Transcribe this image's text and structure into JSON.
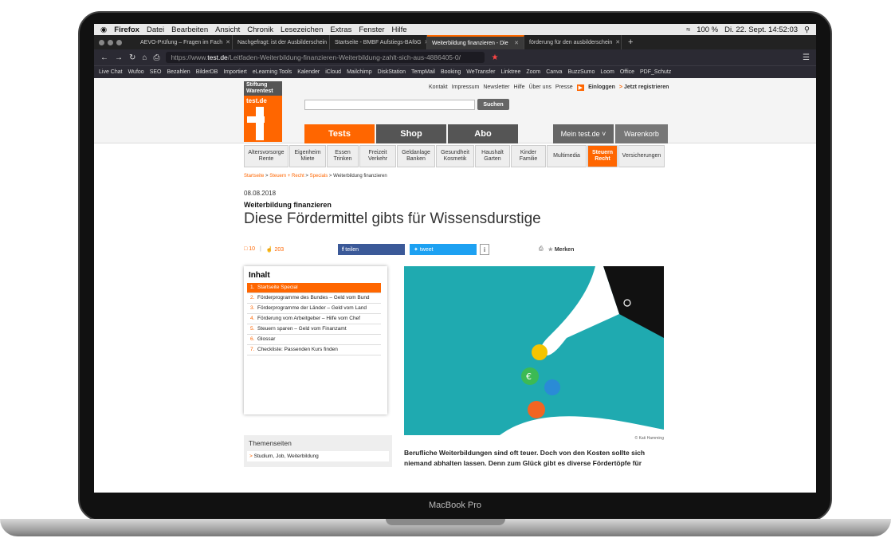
{
  "device": {
    "label": "MacBook Pro"
  },
  "menubar": {
    "apple": "",
    "app": "Firefox",
    "items": [
      "Datei",
      "Bearbeiten",
      "Ansicht",
      "Chronik",
      "Lesezeichen",
      "Extras",
      "Fenster",
      "Hilfe"
    ],
    "battery": "100 %",
    "datetime": "Di. 22. Sept. 14:52:03"
  },
  "tabs": [
    {
      "label": "AEVO-Prüfung – Fragen im Fach"
    },
    {
      "label": "Nachgefragt: ist der Ausbilderschein"
    },
    {
      "label": "Startseite - BMBF Aufstiegs-BAföG"
    },
    {
      "label": "Weiterbildung finanzieren - Die"
    },
    {
      "label": "förderung für den ausbilderschein"
    }
  ],
  "url": {
    "prefix": "https://www.",
    "domain": "test.de",
    "path": "/Leitfaden-Weiterbildung-finanzieren-Weiterbildung-zahlt-sich-aus-4886405-0/"
  },
  "bookmarks": [
    "Live Chat",
    "Wufoo",
    "SEO",
    "Bezahlen",
    "BilderDB",
    "Importiert",
    "eLearning Tools",
    "Kalender",
    "iCloud",
    "Mailchimp",
    "DiskStation",
    "TempMail",
    "Booking",
    "WeTransfer",
    "Linktree",
    "Zoom",
    "Canva",
    "BuzzSumo",
    "Loom",
    "Office",
    "PDF_Schutz"
  ],
  "site": {
    "logo": {
      "line1": "Stiftung",
      "line2": "Warentest",
      "domain": "test.de"
    },
    "toplinks": [
      "Kontakt",
      "Impressum",
      "Newsletter",
      "Hilfe",
      "Über uns",
      "Presse"
    ],
    "login": "Einloggen",
    "register": "Jetzt registrieren",
    "search_button": "Suchen",
    "nav": [
      {
        "label": "Tests",
        "color": "#ff6600"
      },
      {
        "label": "Shop",
        "color": "#555555"
      },
      {
        "label": "Abo",
        "color": "#555555"
      }
    ],
    "mein": "Mein test.de",
    "warenkorb": "Warenkorb",
    "categories": [
      {
        "l1": "Altersvorsorge",
        "l2": "Rente"
      },
      {
        "l1": "Eigenheim",
        "l2": "Miete"
      },
      {
        "l1": "Essen",
        "l2": "Trinken"
      },
      {
        "l1": "Freizeit",
        "l2": "Verkehr"
      },
      {
        "l1": "Geldanlage",
        "l2": "Banken"
      },
      {
        "l1": "Gesundheit",
        "l2": "Kosmetik"
      },
      {
        "l1": "Haushalt",
        "l2": "Garten"
      },
      {
        "l1": "Kinder",
        "l2": "Familie"
      },
      {
        "l1": "Multimedia",
        "l2": ""
      },
      {
        "l1": "Steuern",
        "l2": "Recht"
      },
      {
        "l1": "Versicherungen",
        "l2": ""
      }
    ]
  },
  "breadcrumb": [
    "Startseite",
    "Steuern + Recht",
    "Specials",
    "Weiterbildung finanzieren"
  ],
  "article": {
    "date": "08.08.2018",
    "kicker": "Weiterbildung finanzieren",
    "headline": "Diese Fördermittel gibts für Wissensdurstige",
    "comments": "10",
    "likes": "203",
    "share_fb": "teilen",
    "share_tw": "tweet",
    "info": "i",
    "merken": "Merken",
    "credit": "© Kati Hamming",
    "intro": "Berufliche Weiterbildungen sind oft teuer. Doch von den Kosten sollte sich niemand abhalten lassen. Denn zum Glück gibt es diverse Fördertöpfe für"
  },
  "toc": {
    "title": "Inhalt",
    "items": [
      {
        "n": "1.",
        "label": "Startseite Special"
      },
      {
        "n": "2.",
        "label": "Förderprogramme des Bundes – Geld vom Bund"
      },
      {
        "n": "3.",
        "label": "Förderprogramme der Länder – Geld vom Land"
      },
      {
        "n": "4.",
        "label": "Förderung vom Arbeitgeber – Hilfe vom Chef"
      },
      {
        "n": "5.",
        "label": "Steuern sparen – Geld vom Finanzamt"
      },
      {
        "n": "6.",
        "label": "Glossar"
      },
      {
        "n": "7.",
        "label": "Checkliste: Passenden Kurs finden"
      }
    ]
  },
  "themen": {
    "title": "Themenseiten",
    "item": "Studium, Job, Weiterbildung"
  },
  "dock_colors": [
    "#3b7cd6",
    "#2d6fe0",
    "#e74c3c",
    "#f39c12",
    "#3498db",
    "#27ae60",
    "#e67e22",
    "#c0392b",
    "#16a085",
    "#2980b9",
    "#25d366",
    "#ff5722",
    "#4285f4",
    "#f44336",
    "#2196f3",
    "#8e44ad",
    "#1abc9c",
    "#0078d4",
    "#31a8ff",
    "#ff0000",
    "#ff3366",
    "#e91e63",
    "#ffc107",
    "#4caf50",
    "#9c27b0",
    "#03a9f4",
    "#ff9800",
    "#673ab7",
    "#795548",
    "#3f51b5",
    "#222222",
    "#ff5252",
    "#00bcd4",
    "#8bc34a",
    "#9e9e9e",
    "#607d8b",
    "#cddc39",
    "#aaaaaa",
    "#dddddd"
  ]
}
